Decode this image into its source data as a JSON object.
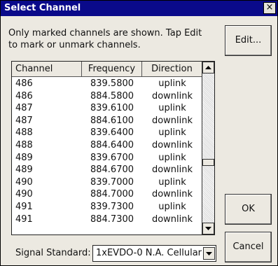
{
  "window": {
    "title": "Select Channel",
    "close_glyph": "×"
  },
  "message": "Only marked channels are shown. Tap Edit to mark or unmark channels.",
  "buttons": {
    "edit": "Edit...",
    "ok": "OK",
    "cancel": "Cancel"
  },
  "table": {
    "columns": [
      "Channel",
      "Frequency",
      "Direction"
    ],
    "rows": [
      [
        "486",
        "839.5800",
        "uplink"
      ],
      [
        "486",
        "884.5800",
        "downlink"
      ],
      [
        "487",
        "839.6100",
        "uplink"
      ],
      [
        "487",
        "884.6100",
        "downlink"
      ],
      [
        "488",
        "839.6400",
        "uplink"
      ],
      [
        "488",
        "884.6400",
        "downlink"
      ],
      [
        "489",
        "839.6700",
        "uplink"
      ],
      [
        "489",
        "884.6700",
        "downlink"
      ],
      [
        "490",
        "839.7000",
        "uplink"
      ],
      [
        "490",
        "884.7000",
        "downlink"
      ],
      [
        "491",
        "839.7300",
        "uplink"
      ],
      [
        "491",
        "884.7300",
        "downlink"
      ]
    ]
  },
  "signal_standard": {
    "label": "Signal Standard:",
    "value": "1xEVDO-0 N.A. Cellular"
  },
  "colors": {
    "titlebar": "#0a0a8a",
    "dialog_bg": "#ece9e1"
  }
}
